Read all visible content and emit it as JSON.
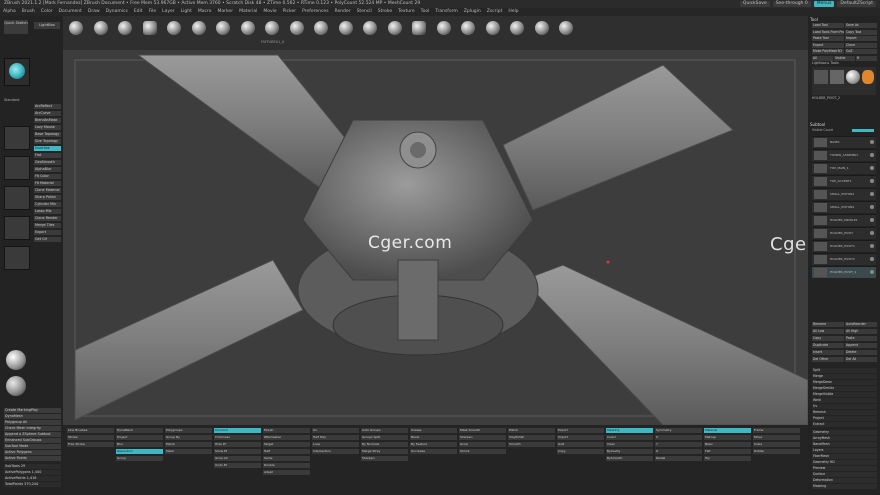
{
  "window": {
    "title": "ZBrush 2021.1.2 [Mark Fernandez]   ZBrush Document   • Free Mem 53.967GB • Active Mem 3760 • Scratch Disk 48 • ZTime 0.562 • RTime 0.123 • PolyCount 52.524 MP • MeshCount 29",
    "quicksave": "QuickSave",
    "see_through": "See-through",
    "see_through_value": "0",
    "menus_label": "Menus",
    "script_label": "DefaultZScript"
  },
  "menubar": [
    "Alpha",
    "Brush",
    "Color",
    "Document",
    "Draw",
    "Dynamics",
    "Edit",
    "File",
    "Layer",
    "Light",
    "Macro",
    "Marker",
    "Material",
    "Movie",
    "Picker",
    "Preferences",
    "Render",
    "Stencil",
    "Stroke",
    "Texture",
    "Tool",
    "Transform",
    "Zplugin",
    "Zscript",
    "Help"
  ],
  "left_panel": {
    "quick_sketch": "Quick Sketch",
    "lightbox": "LightBox",
    "brush_label": "Standard",
    "buttons": [
      "ArcReflect",
      "ArcCurve",
      "BlendAsMask",
      "Lazy Mouse",
      "Base Topology",
      "Size Topology",
      "Invertise",
      "Flat",
      "GeoSmooth",
      "AlphaBlur",
      "Fit Color",
      "Fit Material",
      "Clone Material",
      "Sharp Polish",
      "Cylinder Mix",
      "Lasso Mix",
      "Clone Render",
      "Merge Tiles",
      "Export",
      "Get Gif"
    ],
    "bottom_buttons": [
      "Create MarkingPlay",
      "DynaMesh",
      "Polygroup All",
      "Check Mesh Integrity",
      "Append a ZSphere Subtool",
      "Enhanced SubGroups",
      "SubTool Mode",
      "Active Polygons",
      "Active Points"
    ],
    "stats": [
      "SubTools 29",
      "ActivePolygons 1,440",
      "ActivePoints 1,416",
      "TotalPoints 370,244"
    ]
  },
  "brush_shelf": {
    "labels": [
      "",
      "",
      "",
      "",
      "",
      "",
      "",
      "",
      "FIXTURE01_X",
      "",
      "",
      "",
      "",
      "",
      "",
      "",
      "",
      "",
      "",
      "",
      ""
    ]
  },
  "viewport": {
    "watermark_center": "Cger.com",
    "watermark_right": "Cger.com"
  },
  "right_panel": {
    "title": "Tool",
    "top_buttons": [
      "Load Tool",
      "Save As",
      "Load Tools From Project",
      "Copy Tool",
      "Paste Tool",
      "Import",
      "Export",
      "Clone",
      "Make PolyMesh3D",
      "GoZ",
      "All",
      "Visible",
      "R"
    ],
    "lightbox_tools": "Lightbox ▸ Tools",
    "current_tool": "HOLDER_PIVOT_2",
    "subtool_title": "Subtool",
    "visible_count": "Visible Count",
    "subtools": [
      "BASE1",
      "TOWER_ASSEMBLY",
      "TOP_MAIN_1",
      "TOP_ACCENT1",
      "SMALL_PISTON1",
      "SMALL_PISTON2",
      "HOLDER_MIDDLE1",
      "HOLDER_PIVOT",
      "HOLDER_PIVOT1",
      "HOLDER_PIVOT2",
      "HOLDER_PIVOT_2"
    ],
    "actions": [
      "Rename",
      "AutoReorder",
      "All Low",
      "All High",
      "Copy",
      "Paste",
      "Duplicate",
      "Append",
      "Insert",
      "Delete",
      "Del Other",
      "Del All"
    ],
    "sections": [
      "Split",
      "Merge",
      "MergeDown",
      "MergeSimilar",
      "MergeVisible",
      "Weld",
      "Uv",
      "Remesh",
      "Project",
      "Extract"
    ],
    "bottom_sections": [
      "Geometry",
      "ArrayMesh",
      "NanoMesh",
      "Layers",
      "FiberMesh",
      "Geometry HD",
      "Preview",
      "Surface",
      "Deformation",
      "Masking"
    ]
  },
  "bottom_panel": {
    "columns": [
      [
        "Line Brushes",
        "Stroke",
        "Free Stroke"
      ],
      [
        "DynaMesh",
        "Project",
        "Blur",
        "Resolution",
        "Group"
      ],
      [
        "Polygroups",
        "Group By",
        "Polish",
        "Mesh"
      ],
      [
        "Dynamic",
        "Thickness",
        "Hide Pt",
        "Show Pt",
        "Grow All",
        "Undo Pt"
      ],
      [
        "Morph",
        "ZRemesher",
        "Target",
        "Half",
        "Same",
        "Double",
        "Adapt"
      ],
      [
        "Uv",
        "Half Poly",
        "Loop",
        "Intersection"
      ],
      [
        "Auto Groups",
        "Groups Split",
        "By Normals",
        "Merge Stray",
        "Sharpen"
      ],
      [
        "Crease",
        "Bevel",
        "By Feature",
        "Uncrease"
      ],
      [
        "Mask Smooth",
        "Sharpen",
        "Grow",
        "Shrink"
      ],
      [
        "Polish",
        "ClayPolish",
        "Smooth"
      ],
      [
        "Export",
        "Import",
        "GoZ",
        "Copy"
      ],
      [
        "Masking",
        "Invert",
        "Clear",
        "ByCavity",
        "BySmooth"
      ],
      [
        "Symmetry",
        "X",
        "Y",
        "Z",
        "Radial"
      ],
      [
        "Material",
        "Matcap",
        "Basic",
        "Flat",
        "Toy"
      ],
      [
        "Frame",
        "Move",
        "Scale",
        "Rotate"
      ]
    ]
  },
  "colors": {
    "accent": "#3fb8c4",
    "panel": "#232323",
    "viewport": "#3d3d3d"
  }
}
